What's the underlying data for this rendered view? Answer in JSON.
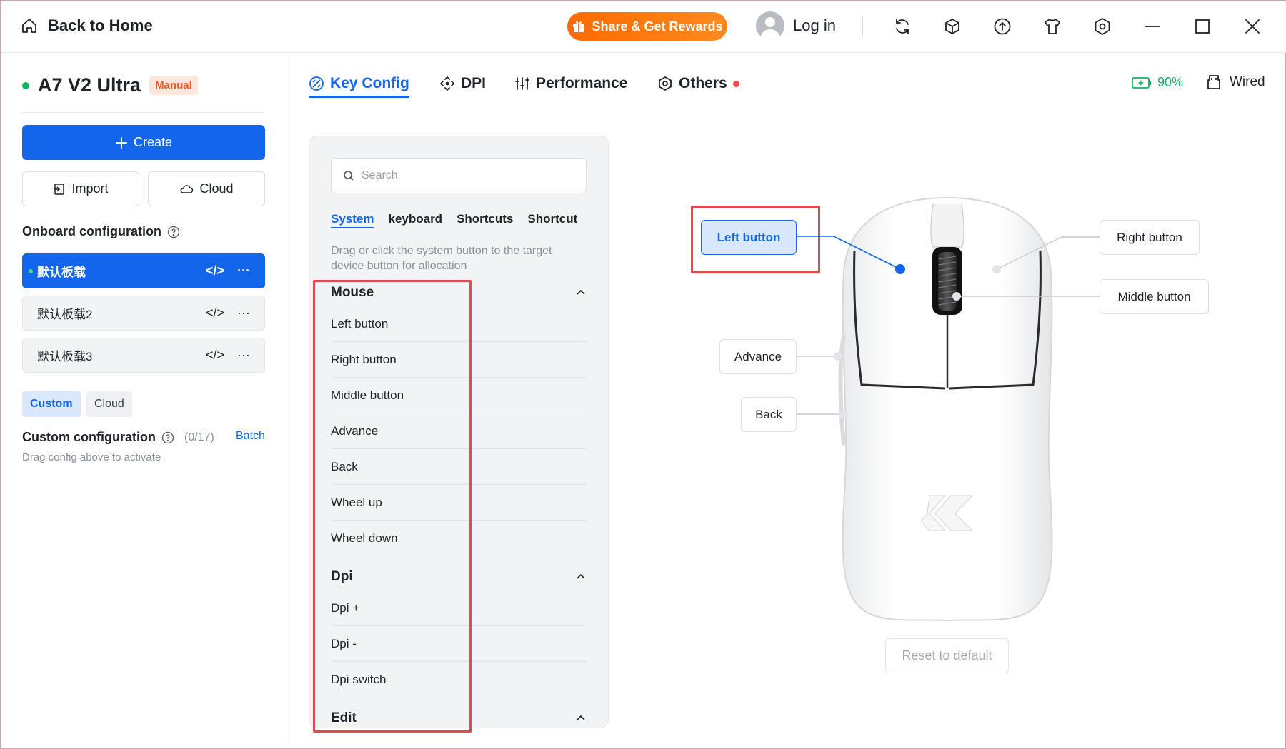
{
  "titlebar": {
    "back_label": "Back to Home",
    "share_label": "Share & Get Rewards",
    "login_label": "Log in"
  },
  "device": {
    "name": "A7 V2 Ultra",
    "mode_badge": "Manual",
    "battery": "90%",
    "connection": "Wired",
    "status_color": "#16b364"
  },
  "sidebar": {
    "create_label": "Create",
    "import_label": "Import",
    "cloud_label": "Cloud",
    "onboard_title": "Onboard configuration",
    "profiles": [
      {
        "name": "默认板载",
        "active": true
      },
      {
        "name": "默认板载2",
        "active": false
      },
      {
        "name": "默认板载3",
        "active": false
      }
    ],
    "chips": {
      "custom": "Custom",
      "cloud": "Cloud"
    },
    "custom_title": "Custom configuration",
    "custom_count": "(0/17)",
    "batch_label": "Batch",
    "drag_hint": "Drag config above to activate"
  },
  "tabs": [
    {
      "label": "Key Config",
      "icon": "key-config-icon",
      "active": true
    },
    {
      "label": "DPI",
      "icon": "dpi-icon",
      "active": false
    },
    {
      "label": "Performance",
      "icon": "sliders-icon",
      "active": false
    },
    {
      "label": "Others",
      "icon": "hexagon-gear-icon",
      "active": false,
      "badge": true
    }
  ],
  "keypanel": {
    "search_placeholder": "Search",
    "subtabs": [
      "System",
      "keyboard",
      "Shortcuts",
      "Shortcut"
    ],
    "hint": "Drag or click the system button to the target device button for allocation",
    "groups": [
      {
        "title": "Mouse",
        "items": [
          "Left button",
          "Right button",
          "Middle button",
          "Advance",
          "Back",
          "Wheel up",
          "Wheel down"
        ]
      },
      {
        "title": "Dpi",
        "items": [
          "Dpi +",
          "Dpi -",
          "Dpi switch"
        ]
      },
      {
        "title": "Edit",
        "items": []
      }
    ]
  },
  "mouse": {
    "left": "Left button",
    "right": "Right button",
    "middle": "Middle button",
    "advance": "Advance",
    "back": "Back",
    "reset_label": "Reset to default"
  },
  "colors": {
    "accent": "#1366ec",
    "share": "#ff7a10",
    "highlight": "#e5484d"
  }
}
